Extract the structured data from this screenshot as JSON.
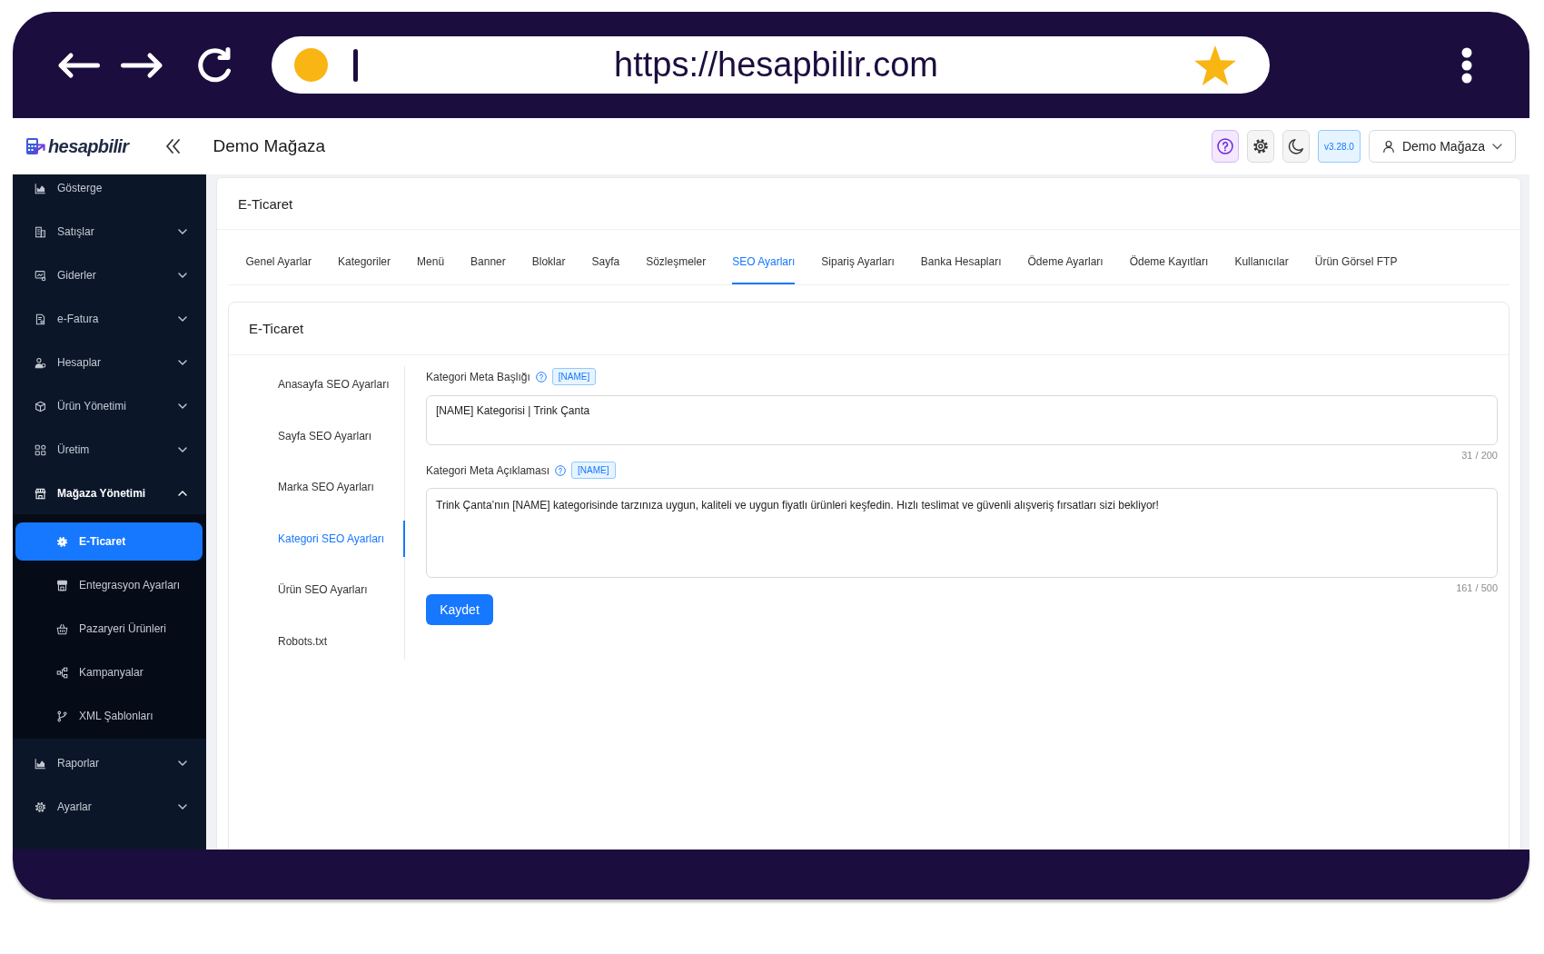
{
  "browser": {
    "url": "https://hesapbilir.com"
  },
  "header": {
    "logo": "hesapbilir",
    "title": "Demo Mağaza",
    "version": "v3.28.0",
    "user_menu": "Demo Mağaza"
  },
  "sidebar": {
    "items": [
      {
        "label": "Gösterge",
        "kind": "link"
      },
      {
        "label": "Satışlar",
        "kind": "group",
        "expanded": false
      },
      {
        "label": "Giderler",
        "kind": "group",
        "expanded": false
      },
      {
        "label": "e-Fatura",
        "kind": "group",
        "expanded": false
      },
      {
        "label": "Hesaplar",
        "kind": "group",
        "expanded": false
      },
      {
        "label": "Ürün Yönetimi",
        "kind": "group",
        "expanded": false
      },
      {
        "label": "Üretim",
        "kind": "group",
        "expanded": false
      },
      {
        "label": "Mağaza Yönetimi",
        "kind": "group",
        "expanded": true,
        "children": [
          {
            "label": "E-Ticaret",
            "selected": true
          },
          {
            "label": "Entegrasyon Ayarları",
            "selected": false
          },
          {
            "label": "Pazaryeri Ürünleri",
            "selected": false
          },
          {
            "label": "Kampanyalar",
            "selected": false
          },
          {
            "label": "XML Şablonları",
            "selected": false
          }
        ]
      },
      {
        "label": "Raporlar",
        "kind": "group",
        "expanded": false
      },
      {
        "label": "Ayarlar",
        "kind": "group",
        "expanded": false
      }
    ]
  },
  "content": {
    "title": "E-Ticaret",
    "tabs": [
      {
        "label": "Genel Ayarlar",
        "selected": false
      },
      {
        "label": "Kategoriler",
        "selected": false
      },
      {
        "label": "Menü",
        "selected": false
      },
      {
        "label": "Banner",
        "selected": false
      },
      {
        "label": "Bloklar",
        "selected": false
      },
      {
        "label": "Sayfa",
        "selected": false
      },
      {
        "label": "Sözleşmeler",
        "selected": false
      },
      {
        "label": "SEO Ayarları",
        "selected": true
      },
      {
        "label": "Sipariş Ayarları",
        "selected": false
      },
      {
        "label": "Banka Hesapları",
        "selected": false
      },
      {
        "label": "Ödeme Ayarları",
        "selected": false
      },
      {
        "label": "Ödeme Kayıtları",
        "selected": false
      },
      {
        "label": "Kullanıcılar",
        "selected": false
      },
      {
        "label": "Ürün Görsel FTP",
        "selected": false
      }
    ],
    "panel": {
      "title": "E-Ticaret",
      "nav": [
        {
          "label": "Anasayfa SEO Ayarları",
          "selected": false
        },
        {
          "label": "Sayfa SEO Ayarları",
          "selected": false
        },
        {
          "label": "Marka SEO Ayarları",
          "selected": false
        },
        {
          "label": "Kategori SEO Ayarları",
          "selected": true
        },
        {
          "label": "Ürün SEO Ayarları",
          "selected": false
        },
        {
          "label": "Robots.txt",
          "selected": false
        }
      ],
      "fields": [
        {
          "kind": "input",
          "label": "Kategori Meta Başlığı",
          "tag": "[NAME]",
          "value": "[NAME] Kategorisi | Trink Çanta",
          "counter": "31 / 200"
        },
        {
          "kind": "textarea",
          "label": "Kategori Meta Açıklaması",
          "tag": "[NAME]",
          "value": "Trink Çanta’nın [NAME] kategorisinde tarzınıza uygun, kaliteli ve uygun fiyatlı ürünleri keşfedin. Hızlı teslimat ve güvenli alışveriş fırsatları sizi bekliyor!",
          "counter": "161 / 500"
        }
      ],
      "save_button": "Kaydet"
    }
  }
}
